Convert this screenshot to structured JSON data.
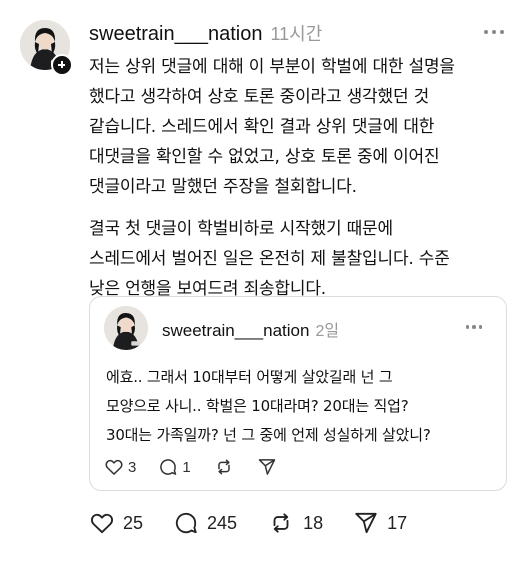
{
  "post": {
    "username": "sweetrain___nation",
    "time": "11시간",
    "body_lines": [
      "저는 상위 댓글에 대해 이 부분이 학벌에 대한 설명을",
      "했다고 생각하여 상호 토론 중이라고 생각했던 것",
      "같습니다. 스레드에서 확인 결과 상위 댓글에 대한",
      "대댓글을 확인할 수 없었고,  상호 토론 중에 이어진",
      "댓글이라고 말했던 주장을 철회합니다."
    ],
    "body_lines_2": [
      "결국 첫 댓글이 학벌비하로 시작했기 때문에",
      "스레드에서 벌어진 일은 온전히 제 불찰입니다. 수준",
      "낮은 언행을 보여드려 죄송합니다."
    ],
    "likes": "25",
    "comments": "245",
    "reposts": "18",
    "shares": "17"
  },
  "quoted": {
    "username": "sweetrain___nation",
    "time": "2일",
    "body_lines": [
      "에효.. 그래서 10대부터 어떻게 살았길래 넌 그",
      "모양으로 사니.. 학벌은 10대라며? 20대는 직업?",
      "30대는 가족일까? 넌 그 중에 언제 성실하게 살았니?"
    ],
    "likes": "3",
    "comments": "1"
  },
  "icons": {
    "like": "heart-icon",
    "comment": "comment-bubble-icon",
    "repost": "repost-icon",
    "share": "send-icon",
    "more": "more-dots-icon",
    "follow": "plus-icon"
  }
}
